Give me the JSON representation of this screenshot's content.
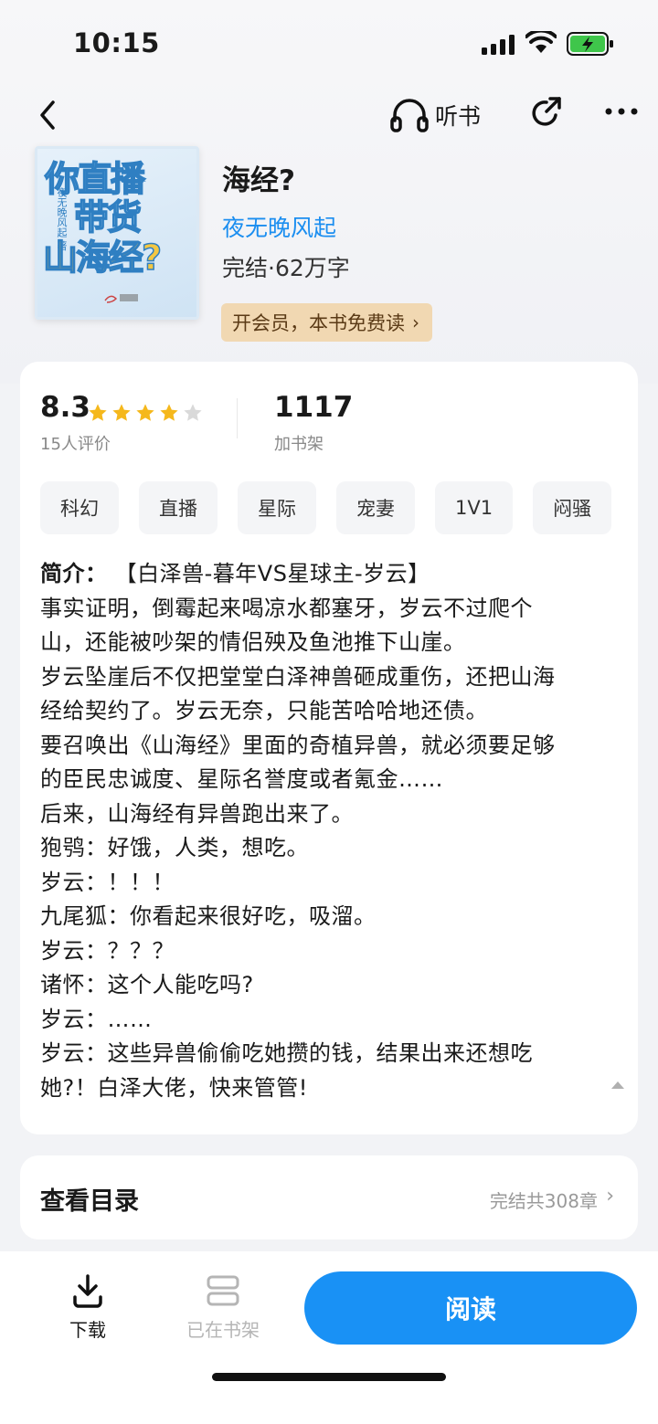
{
  "status_bar": {
    "time": "10:15"
  },
  "nav": {
    "listen_label": "听书"
  },
  "cover": {
    "title_line1": "你直播",
    "title_line2": "带货",
    "title_line3": "山海经?",
    "author_vertical": "夜无晚风起 著"
  },
  "book": {
    "title": "海经?",
    "author": "夜无晚风起",
    "meta": "完结·62万字",
    "vip_label": "开会员，本书免费读",
    "vip_chevron": "›"
  },
  "stats": {
    "rating": "8.3",
    "stars_filled": 4,
    "rating_count": "15人评价",
    "shelf_count": "1117",
    "shelf_label": "加书架"
  },
  "tags": [
    "科幻",
    "直播",
    "星际",
    "宠妻",
    "1V1",
    "闷骚"
  ],
  "intro": {
    "label": "简介：",
    "lines": [
      "【白泽兽-暮年VS星球主-岁云】",
      "事实证明，倒霉起来喝凉水都塞牙，岁云不过爬个",
      "山，还能被吵架的情侣殃及鱼池推下山崖。",
      "岁云坠崖后不仅把堂堂白泽神兽砸成重伤，还把山海",
      "经给契约了。岁云无奈，只能苦哈哈地还债。",
      "要召唤出《山海经》里面的奇植异兽，就必须要足够",
      "的臣民忠诚度、星际名誉度或者氪金……",
      "后来，山海经有异兽跑出来了。",
      "狍鸮：好饿，人类，想吃。",
      "岁云：！！！",
      "九尾狐：你看起来很好吃，吸溜。",
      "岁云：？？？",
      "诸怀：这个人能吃吗?",
      "岁云：……",
      "岁云：这些异兽偷偷吃她攒的钱，结果出来还想吃",
      "她?！白泽大佬，快来管管!"
    ]
  },
  "catalog": {
    "title": "查看目录",
    "status": "完结共308章",
    "chevron": "›"
  },
  "bottom": {
    "download_label": "下载",
    "shelf_label": "已在书架",
    "read_label": "阅读"
  },
  "colors": {
    "accent": "#1991f5",
    "author_link": "#1b8ef0",
    "vip_bg": "#f1d8b2",
    "star": "#f5b81c",
    "star_empty": "#d9d9d9"
  }
}
